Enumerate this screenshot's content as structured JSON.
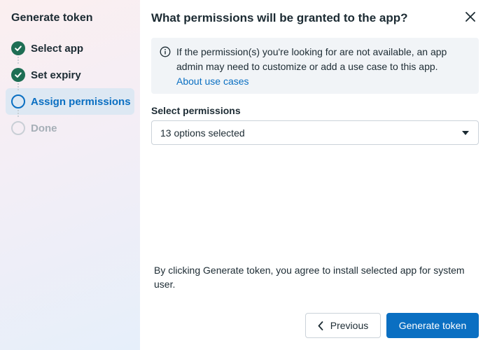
{
  "sidebar": {
    "title": "Generate token",
    "steps": [
      {
        "label": "Select app",
        "status": "done"
      },
      {
        "label": "Set expiry",
        "status": "done"
      },
      {
        "label": "Assign permissions",
        "status": "current"
      },
      {
        "label": "Done",
        "status": "pending"
      }
    ]
  },
  "main": {
    "title": "What permissions will be granted to the app?",
    "info": {
      "text": "If the permission(s) you're looking for are not available, an app admin may need to customize or add a use case to this app.",
      "link": "About use cases"
    },
    "permissions": {
      "label": "Select permissions",
      "value": "13 options selected"
    },
    "consent": "By clicking Generate token, you agree to install selected app for system user.",
    "buttons": {
      "previous": "Previous",
      "generate": "Generate token"
    }
  },
  "colors": {
    "accent": "#0a6fc2",
    "done": "#1e6e54",
    "pending": "#a6afb7"
  },
  "icons": [
    "checkmark-icon",
    "info-icon",
    "close-icon",
    "caret-down-icon",
    "chevron-left-icon"
  ]
}
